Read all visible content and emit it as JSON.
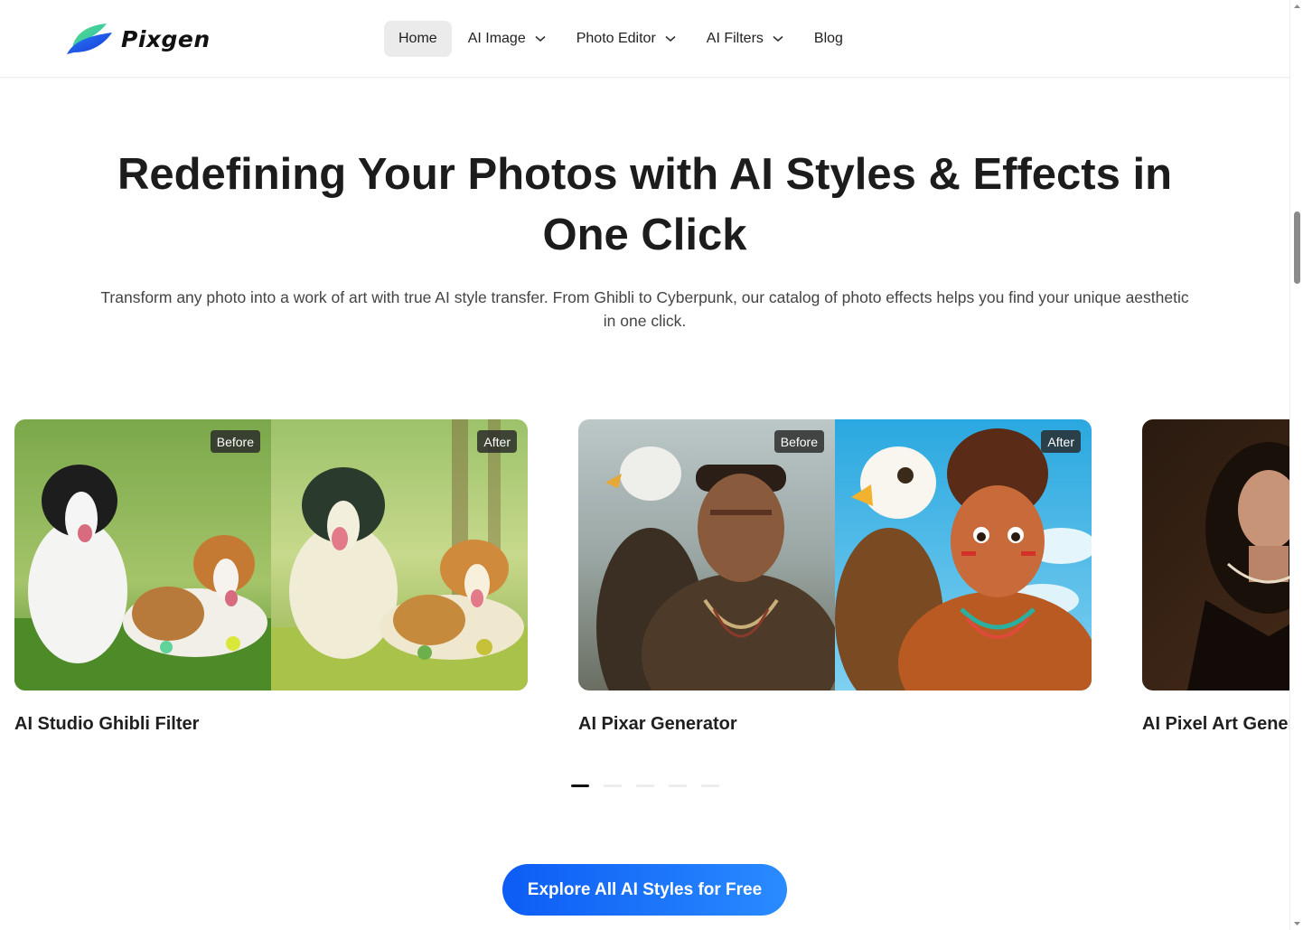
{
  "brand": {
    "name": "Pixgen"
  },
  "nav": {
    "items": [
      {
        "label": "Home",
        "active": true,
        "dropdown": false
      },
      {
        "label": "AI Image",
        "active": false,
        "dropdown": true
      },
      {
        "label": "Photo Editor",
        "active": false,
        "dropdown": true
      },
      {
        "label": "AI Filters",
        "active": false,
        "dropdown": true
      },
      {
        "label": "Blog",
        "active": false,
        "dropdown": false
      }
    ]
  },
  "hero": {
    "title": "Redefining Your Photos with AI Styles & Effects in One Click",
    "subtitle": "Transform any photo into a work of art with true AI style transfer. From Ghibli to Cyberpunk, our catalog of photo effects helps you find your unique aesthetic in one click."
  },
  "cards": [
    {
      "title": "AI Studio Ghibli Filter",
      "before_label": "Before",
      "after_label": "After"
    },
    {
      "title": "AI Pixar Generator",
      "before_label": "Before",
      "after_label": "After"
    },
    {
      "title": "AI Pixel Art Generator"
    }
  ],
  "carousel": {
    "page_count": 5,
    "active_index": 0
  },
  "cta": {
    "label": "Explore All AI Styles for Free"
  },
  "colors": {
    "accent": "#1a6ff5",
    "text": "#1c1c1c",
    "muted": "#444444"
  }
}
